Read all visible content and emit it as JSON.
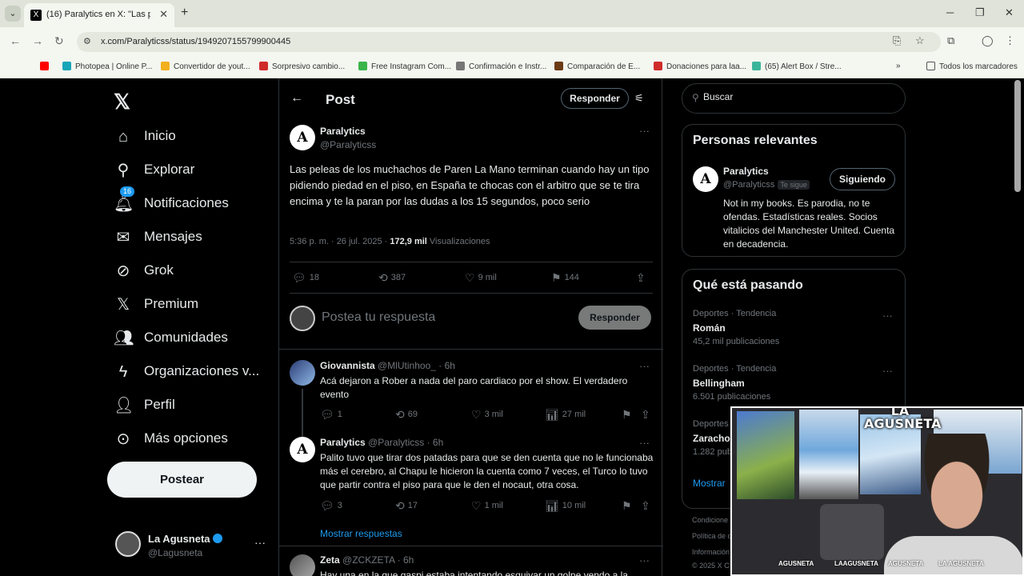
{
  "browser": {
    "tab_title": "(16) Paralytics en X: \"Las peleas",
    "url": "x.com/Paralyticss/status/1949207155799900445",
    "bookmarks": [
      {
        "label": "",
        "color": "#ff0000"
      },
      {
        "label": "Photopea | Online P...",
        "color": "#19a5b8"
      },
      {
        "label": "Convertidor de yout...",
        "color": "#f2b01e"
      },
      {
        "label": "Sorpresivo cambio...",
        "color": "#d02b2b"
      },
      {
        "label": "Free Instagram Com...",
        "color": "#3ab54a"
      },
      {
        "label": "Confirmación e Instr...",
        "color": "#777777"
      },
      {
        "label": "Comparación de E...",
        "color": "#6b3b16"
      },
      {
        "label": "Donaciones para laa...",
        "color": "#d02b2b"
      },
      {
        "label": "(65) Alert Box / Stre...",
        "color": "#3bb59a"
      }
    ],
    "all_bookmarks": "Todos los marcadores"
  },
  "nav": {
    "items": [
      {
        "label": "Inicio",
        "icon": "home-icon",
        "glyph": "⌂"
      },
      {
        "label": "Explorar",
        "icon": "search-icon",
        "glyph": "⚲"
      },
      {
        "label": "Notificaciones",
        "icon": "bell-icon",
        "glyph": "🔔︎",
        "badge": "16"
      },
      {
        "label": "Mensajes",
        "icon": "mail-icon",
        "glyph": "✉"
      },
      {
        "label": "Grok",
        "icon": "grok-icon",
        "glyph": "⊘"
      },
      {
        "label": "Premium",
        "icon": "x-icon",
        "glyph": "𝕏"
      },
      {
        "label": "Comunidades",
        "icon": "people-icon",
        "glyph": "👥︎"
      },
      {
        "label": "Organizaciones v...",
        "icon": "lightning-icon",
        "glyph": "ϟ"
      },
      {
        "label": "Perfil",
        "icon": "person-icon",
        "glyph": "👤︎"
      },
      {
        "label": "Más opciones",
        "icon": "more-circle-icon",
        "glyph": "⊙"
      }
    ],
    "post_button": "Postear",
    "account": {
      "name": "La Agusneta",
      "handle": "@Lagusneta"
    }
  },
  "post": {
    "header_title": "Post",
    "header_reply": "Responder",
    "author_name": "Paralytics",
    "author_handle": "@Paralyticss",
    "text": "Las peleas de los muchachos de Paren La Mano terminan cuando hay un tipo pidiendo piedad en el piso, en España te chocas con el arbitro que se te tira encima y te la paran por las dudas a los 15 segundos, poco serio",
    "time": "5:36 p. m. · 26 jul. 2025 · ",
    "views": "172,9 mil",
    "views_label": " Visualizaciones",
    "replies": "18",
    "reposts": "387",
    "likes": "9 mil",
    "bookmarks": "144",
    "compose_placeholder": "Postea tu respuesta",
    "compose_button": "Responder"
  },
  "replies": [
    {
      "name": "Giovannista",
      "handle": "@MlUtinhoo_ · 6h",
      "text": "Acá dejaron a Rober a nada del paro cardiaco por el show. El verdadero evento",
      "replies": "1",
      "reposts": "69",
      "likes": "3 mil",
      "views": "27 mil"
    },
    {
      "name": "Paralytics",
      "handle": "@Paralyticss · 6h",
      "text": "Palito tuvo que tirar dos patadas para que se den cuenta que no le funcionaba más el cerebro, al Chapu le hicieron la cuenta como 7 veces, el Turco lo tuvo que partir contra el piso para que le den el nocaut, otra cosa.",
      "replies": "3",
      "reposts": "17",
      "likes": "1 mil",
      "views": "10 mil"
    },
    {
      "name": "Zeta",
      "handle": "@ZCKZETA · 6h",
      "text": "Hay una en la que gaspi estaba intentando esquivar un golpe yendo a la"
    }
  ],
  "show_replies": "Mostrar respuestas",
  "sidebar": {
    "search_placeholder": "Buscar",
    "relevant_title": "Personas relevantes",
    "relevant": {
      "name": "Paralytics",
      "handle": "@Paralyticss",
      "follows_you": "Te sigue",
      "button": "Siguiendo",
      "bio": "Not in my books. Es parodia, no te ofendas. Estadísticas reales. Socios vitalicios del Manchester United. Cuenta en decadencia."
    },
    "trends_title": "Qué está pasando",
    "trends": [
      {
        "category": "Deportes · Tendencia",
        "name": "Román",
        "count": "45,2 mil publicaciones"
      },
      {
        "category": "Deportes · Tendencia",
        "name": "Bellingham",
        "count": "6.501 publicaciones"
      },
      {
        "category": "Deportes",
        "name": "Zaracho",
        "count": "1.282 pub"
      }
    ],
    "show_more": "Mostrar",
    "footer": [
      "Condicione",
      "Política de c",
      "Información",
      "© 2025 X C"
    ]
  },
  "webcam": {
    "logo": "LA AGUSNETA",
    "strip": [
      "AGUSNETA",
      "LAAGUSNETA",
      "AGUSNETA",
      "LA AGUSNETA"
    ]
  }
}
